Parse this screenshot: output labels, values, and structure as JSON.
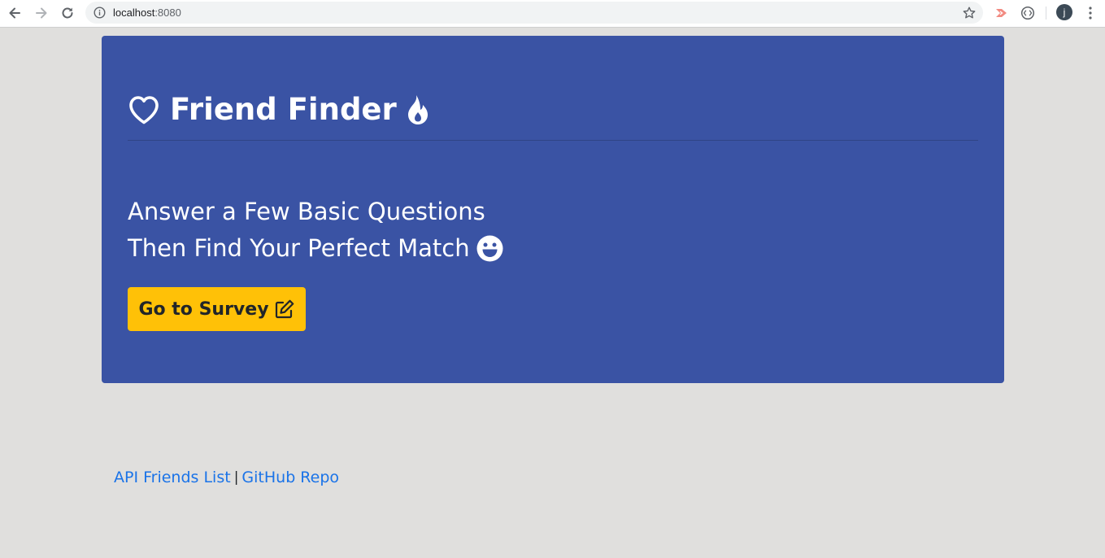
{
  "browser": {
    "url_host": "localhost",
    "url_port": ":8080",
    "profile_initial": "j",
    "icons": [
      "back-arrow-icon",
      "forward-arrow-icon",
      "reload-icon",
      "info-icon",
      "star-icon",
      "extension-icon",
      "profile-avatar",
      "more-menu-icon"
    ]
  },
  "hero": {
    "title": "Friend Finder",
    "lead_line1": "Answer a Few Basic Questions",
    "lead_line2": "Then Find Your Perfect Match",
    "button_label": "Go to Survey",
    "icons": [
      "heart-icon",
      "fire-icon",
      "smile-icon",
      "edit-icon"
    ]
  },
  "footer": {
    "link1": "API Friends List",
    "separator": "|",
    "link2": "GitHub Repo"
  },
  "colors": {
    "page_bg": "#e0dfdd",
    "hero_bg": "#3a53a4",
    "button_bg": "#ffc107",
    "link": "#1a73e8"
  }
}
